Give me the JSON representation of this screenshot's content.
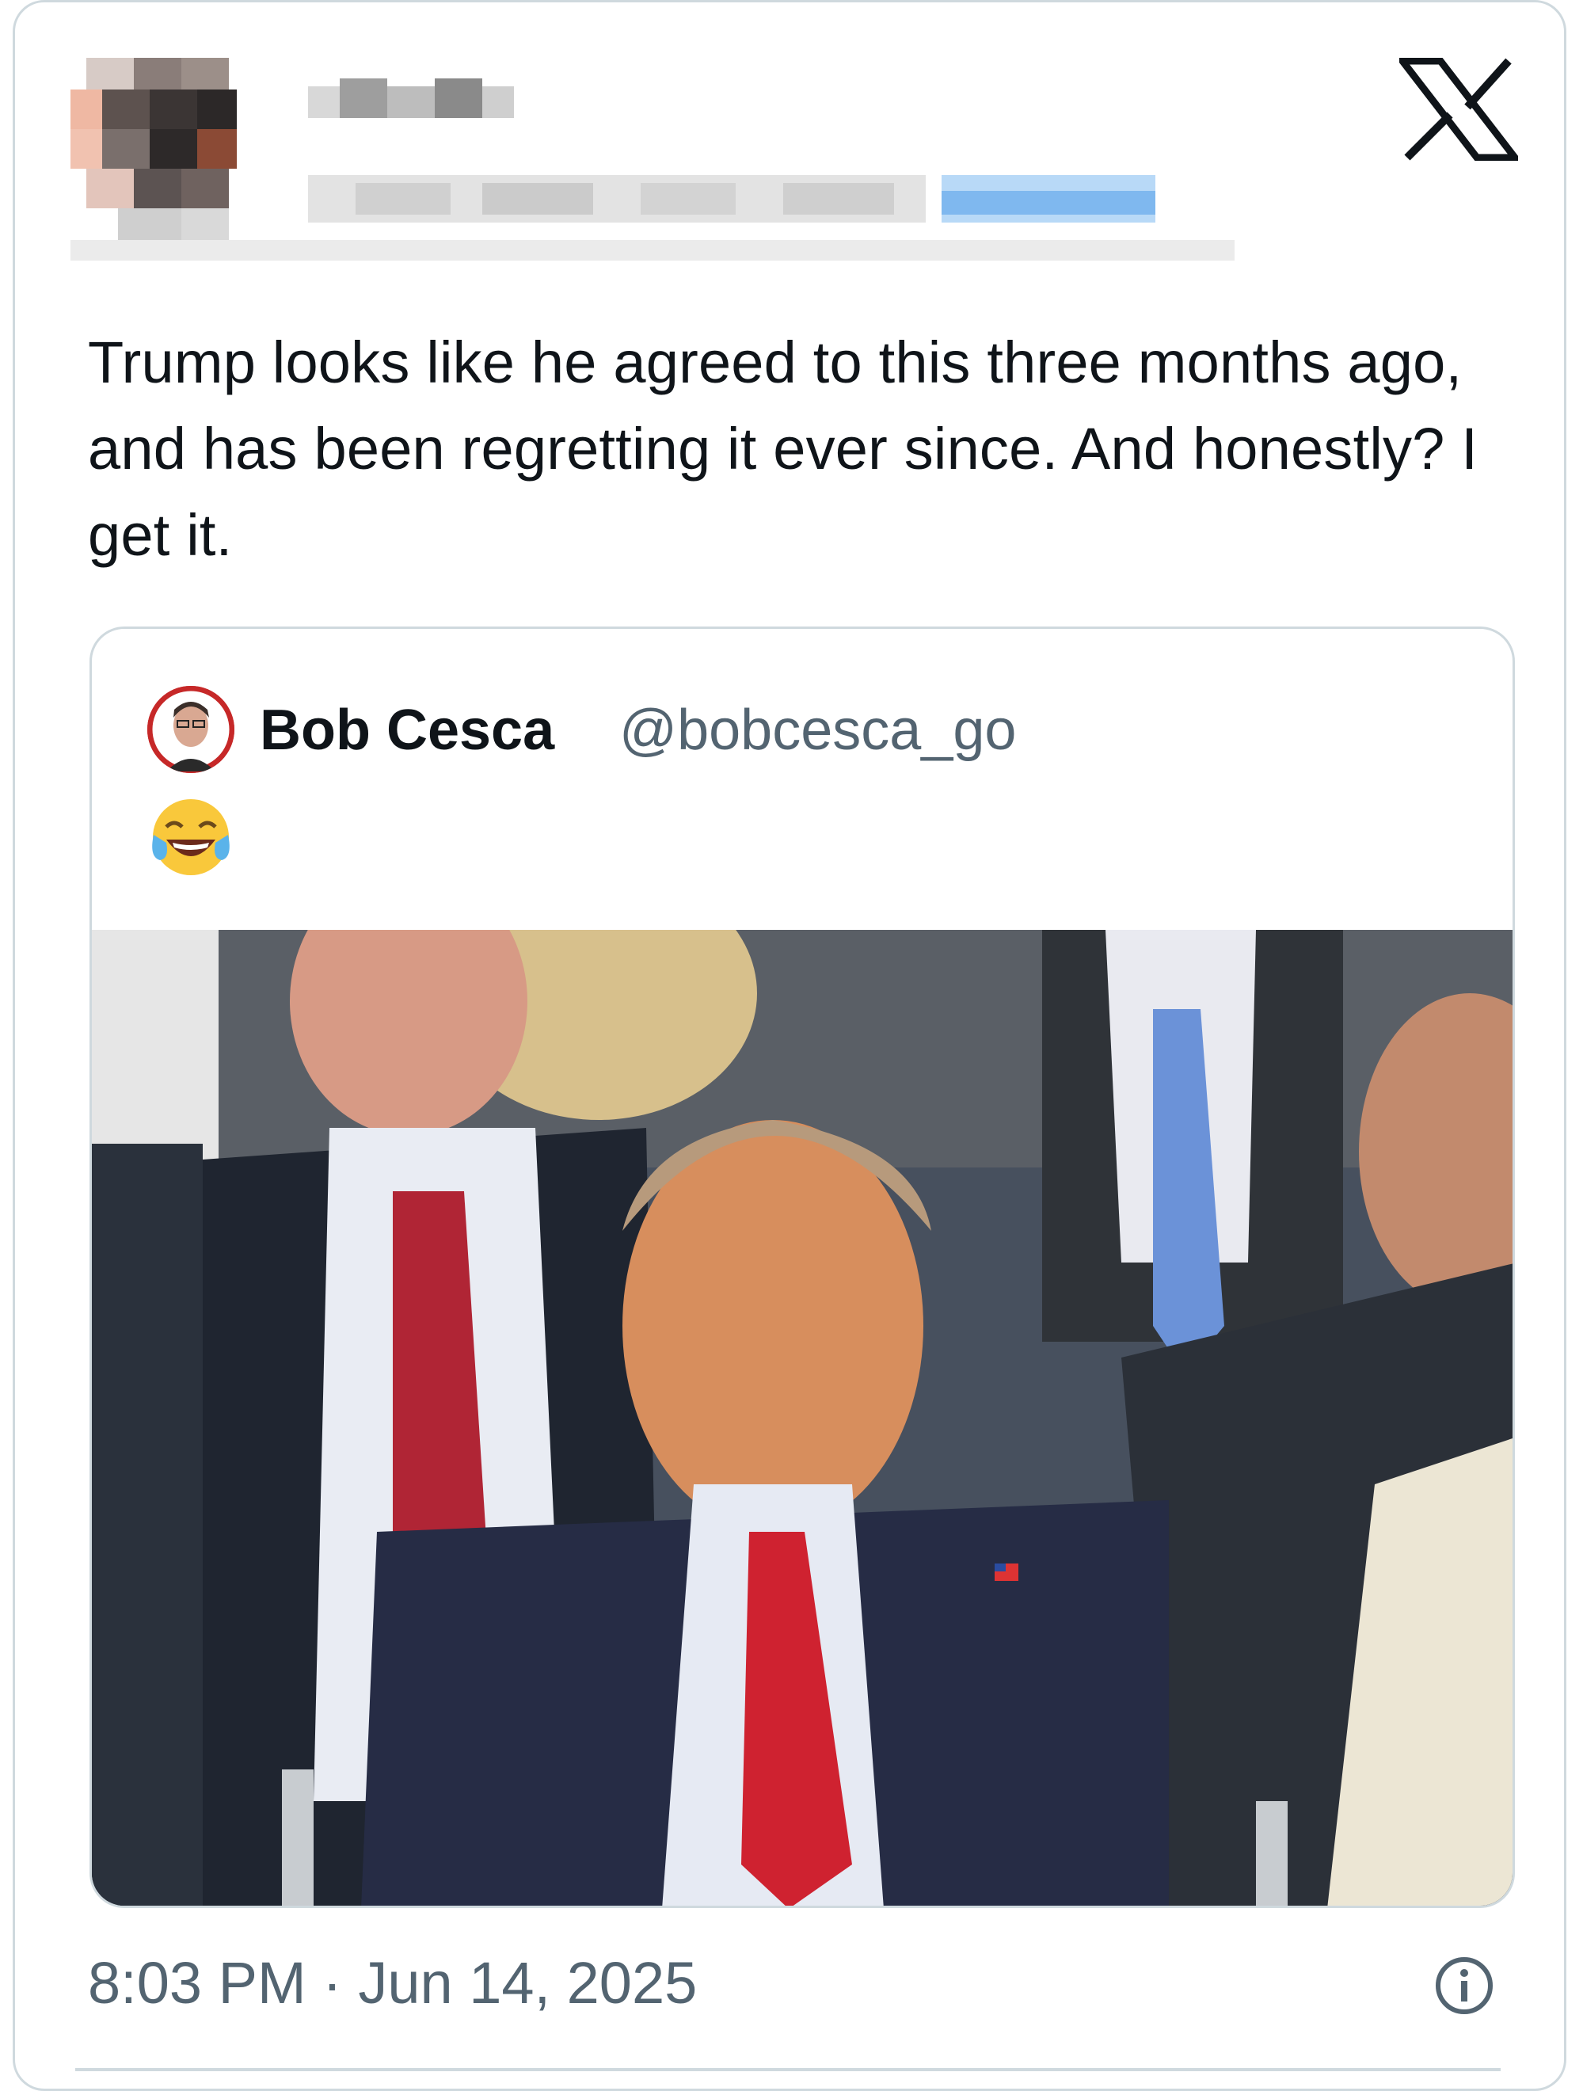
{
  "tweet": {
    "text": "Trump looks like he agreed to this three months ago, and has been regretting it ever since. And honestly? I get it.",
    "timestamp": "8:03 PM · Jun 14, 2025",
    "brand_icon": "x-logo-icon",
    "info_icon": "info-icon"
  },
  "quoted": {
    "name": "Bob Cesca",
    "handle": "@bobcesca_go",
    "emoji": "😂"
  },
  "colors": {
    "text": "#0f1419",
    "secondary": "#536471",
    "border": "#cfd9de",
    "avatar_ring": "#c62828"
  }
}
